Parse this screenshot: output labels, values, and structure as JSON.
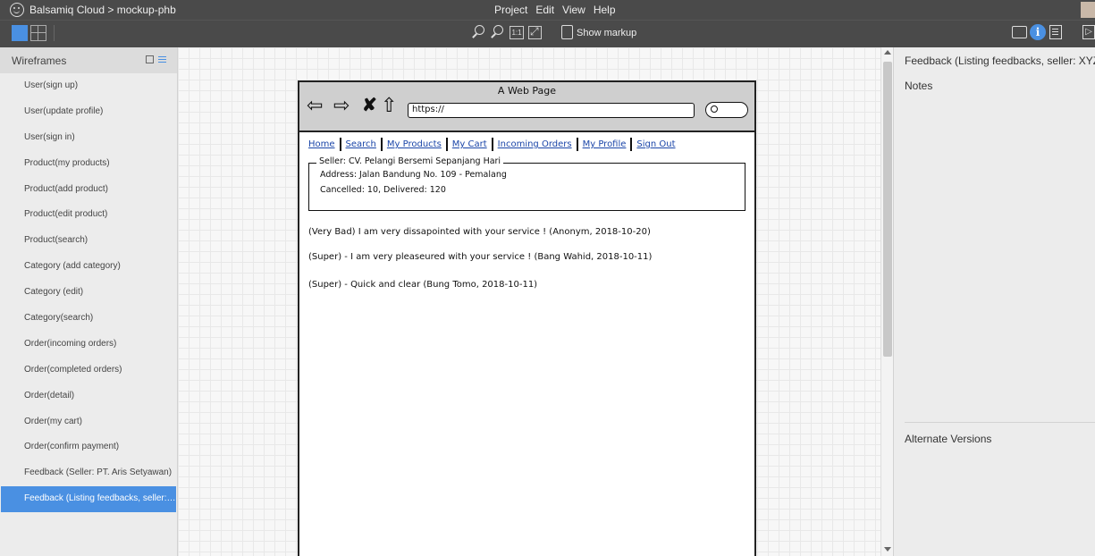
{
  "app": {
    "title": "Balsamiq Cloud > mockup-phb",
    "menu": [
      "Project",
      "Edit",
      "View",
      "Help"
    ]
  },
  "toolbar": {
    "show_markup_label": "Show markup",
    "one_to_one_label": "1:1",
    "info_label": "i",
    "play_label": "▷"
  },
  "sidebar": {
    "title": "Wireframes",
    "items": [
      {
        "label": "User(sign up)"
      },
      {
        "label": "User(update profile)"
      },
      {
        "label": "User(sign in)"
      },
      {
        "label": "Product(my products)"
      },
      {
        "label": "Product(add product)"
      },
      {
        "label": "Product(edit product)"
      },
      {
        "label": "Product(search)"
      },
      {
        "label": "Category (add category)"
      },
      {
        "label": "Category (edit)"
      },
      {
        "label": "Category(search)"
      },
      {
        "label": "Order(incoming orders)"
      },
      {
        "label": "Order(completed orders)"
      },
      {
        "label": "Order(detail)"
      },
      {
        "label": "Order(my cart)"
      },
      {
        "label": "Order(confirm payment)"
      },
      {
        "label": "Feedback (Seller: PT. Aris Setyawan)"
      },
      {
        "label": "Feedback (Listing feedbacks, seller: XYZ)"
      }
    ],
    "selected_index": 16
  },
  "mockup": {
    "window_title": "A Web Page",
    "url": "https://",
    "nav_links": [
      "Home",
      "Search",
      "My Products",
      "My Cart",
      "Incoming Orders",
      "My Profile",
      "Sign Out"
    ],
    "seller_box": {
      "legend": "Seller: CV. Pelangi Bersemi Sepanjang Hari",
      "address": "Address:  Jalan Bandung No. 109 - Pemalang",
      "stats": "Cancelled: 10, Delivered: 120"
    },
    "feedbacks": [
      "(Very Bad) I am very dissapointed with your service ! (Anonym, 2018-10-20)",
      "(Super) - I am very pleaseured with your service ! (Bang Wahid, 2018-10-11)",
      "(Super) - Quick and clear (Bung Tomo, 2018-10-11)"
    ]
  },
  "right_panel": {
    "title": "Feedback (Listing feedbacks, seller: XYZ)",
    "notes_label": "Notes",
    "versions_label": "Alternate Versions"
  },
  "colors": {
    "accent": "#4a90e2",
    "chrome": "#4a4a4a",
    "link": "#1a45a8"
  }
}
